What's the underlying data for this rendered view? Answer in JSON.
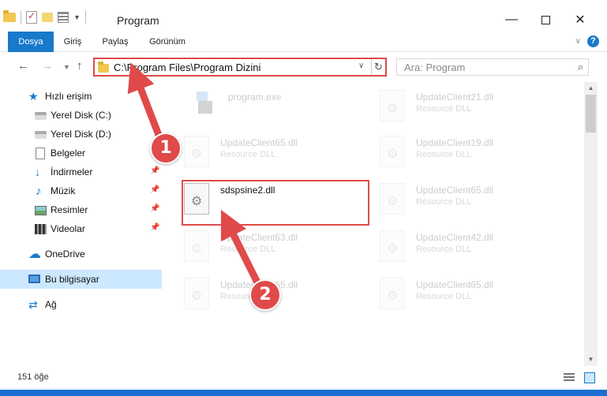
{
  "window": {
    "title": "Program",
    "controls": {
      "minimize": "—",
      "maximize": "",
      "close": "✕"
    }
  },
  "ribbon": {
    "tabs": [
      {
        "label": "Dosya",
        "active": true
      },
      {
        "label": "Giriş"
      },
      {
        "label": "Paylaş"
      },
      {
        "label": "Görünüm"
      }
    ],
    "help_label": "?"
  },
  "navbar": {
    "back": "←",
    "forward": "→",
    "up": "↑",
    "address": "C:\\Program Files\\Program Dizini",
    "search_placeholder": "Ara: Program"
  },
  "sidebar": {
    "items": [
      {
        "label": "Hızlı erişim",
        "icon": "star-icon"
      },
      {
        "label": "Yerel Disk (C:)",
        "icon": "disk-icon",
        "pinned": true
      },
      {
        "label": "Yerel Disk (D:)",
        "icon": "disk-icon",
        "pinned": true
      },
      {
        "label": "Belgeler",
        "icon": "documents-icon",
        "pinned": true
      },
      {
        "label": "İndirmeler",
        "icon": "downloads-icon",
        "pinned": true
      },
      {
        "label": "Müzik",
        "icon": "music-icon",
        "pinned": true
      },
      {
        "label": "Resimler",
        "icon": "pictures-icon",
        "pinned": true
      },
      {
        "label": "Videolar",
        "icon": "videos-icon",
        "pinned": true
      },
      {
        "label": "OneDrive",
        "icon": "onedrive-icon"
      },
      {
        "label": "Bu bilgisayar",
        "icon": "this-pc-icon",
        "selected": true
      },
      {
        "label": "Ağ",
        "icon": "network-icon"
      }
    ]
  },
  "files": [
    {
      "name": "program.exe",
      "type": "",
      "faded": true
    },
    {
      "name": "UpdateClient21.dll",
      "type": "Resource DLL",
      "faded": true
    },
    {
      "name": "UpdateClient65.dll",
      "type": "Resource DLL",
      "faded": true
    },
    {
      "name": "UpdateClient19.dll",
      "type": "Resource DLL",
      "faded": true
    },
    {
      "name": "sdspsine2.dll",
      "type": "",
      "faded": false,
      "highlighted": true
    },
    {
      "name": "UpdateClient65.dll",
      "type": "Resource DLL",
      "faded": true
    },
    {
      "name": "UpdateClient63.dll",
      "type": "Resource DLL",
      "faded": true
    },
    {
      "name": "UpdateClient42.dll",
      "type": "Resource DLL",
      "faded": true
    },
    {
      "name": "UpdateClient65.dll",
      "type": "Resource DLL",
      "faded": true
    },
    {
      "name": "UpdateClient65.dll",
      "type": "Resource DLL",
      "faded": true
    }
  ],
  "status": {
    "item_count": "151 öğe"
  },
  "annotations": {
    "step1": "1",
    "step2": "2",
    "color": "#e04a4a"
  },
  "colors": {
    "accent": "#1979ca",
    "highlight": "#e04a4a",
    "selected": "#cce8ff"
  }
}
